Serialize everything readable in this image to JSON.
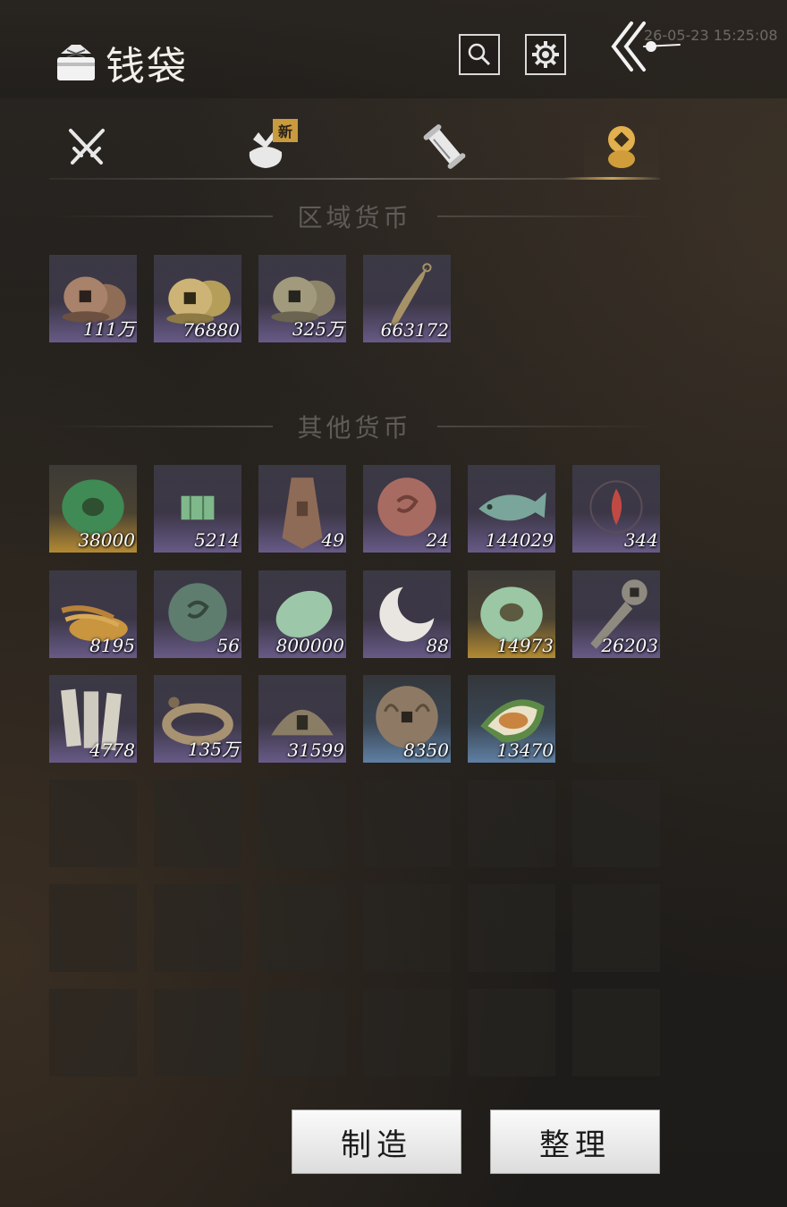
{
  "header": {
    "title": "钱袋",
    "timestamp": "26-05-23 15:25:08"
  },
  "tabs": [
    {
      "id": "weapon",
      "icon": "crossed-swords-icon",
      "active": false
    },
    {
      "id": "bag",
      "icon": "cloth-bundle-icon",
      "active": false,
      "badge": "新"
    },
    {
      "id": "scroll",
      "icon": "scroll-icon",
      "active": false
    },
    {
      "id": "currency",
      "icon": "currency-coin-icon",
      "active": true
    }
  ],
  "sections": {
    "regional": "区域货币",
    "other": "其他货币"
  },
  "regional_items": [
    {
      "icon": "copper-coin-stack-icon",
      "count": "111万",
      "rarity": "purple"
    },
    {
      "icon": "gold-coin-stack-icon",
      "count": "76880",
      "rarity": "purple"
    },
    {
      "icon": "silver-coin-stack-icon",
      "count": "325万",
      "rarity": "purple"
    },
    {
      "icon": "knife-blade-icon",
      "count": "663172",
      "rarity": "purple"
    }
  ],
  "other_items": [
    {
      "icon": "jade-disc-icon",
      "count": "38000",
      "rarity": "gold"
    },
    {
      "icon": "map-token-icon",
      "count": "5214",
      "rarity": "purple"
    },
    {
      "icon": "bronze-plaque-icon",
      "count": "49",
      "rarity": "purple"
    },
    {
      "icon": "red-stone-coin-icon",
      "count": "24",
      "rarity": "purple"
    },
    {
      "icon": "jade-fish-icon",
      "count": "144029",
      "rarity": "purple"
    },
    {
      "icon": "red-flame-emblem-icon",
      "count": "344",
      "rarity": "purple"
    },
    {
      "icon": "grain-pile-icon",
      "count": "8195",
      "rarity": "purple"
    },
    {
      "icon": "green-stone-coin-icon",
      "count": "56",
      "rarity": "purple"
    },
    {
      "icon": "jade-pebble-icon",
      "count": "800000",
      "rarity": "purple"
    },
    {
      "icon": "crescent-moon-icon",
      "count": "88",
      "rarity": "purple"
    },
    {
      "icon": "jade-ring-icon",
      "count": "14973",
      "rarity": "gold"
    },
    {
      "icon": "coin-sword-icon",
      "count": "26203",
      "rarity": "purple"
    },
    {
      "icon": "paper-notes-icon",
      "count": "4778",
      "rarity": "purple"
    },
    {
      "icon": "coin-string-icon",
      "count": "135万",
      "rarity": "purple"
    },
    {
      "icon": "half-coin-icon",
      "count": "31599",
      "rarity": "purple"
    },
    {
      "icon": "engraved-coin-icon",
      "count": "8350",
      "rarity": "blue"
    },
    {
      "icon": "melon-slice-icon",
      "count": "13470",
      "rarity": "blue"
    }
  ],
  "buttons": {
    "craft": "制造",
    "sort": "整理"
  },
  "colors": {
    "accent_gold": "#c9a35a",
    "rarity_purple": "#675a86",
    "rarity_gold": "#b38a33",
    "rarity_blue": "#5f7fa3"
  }
}
